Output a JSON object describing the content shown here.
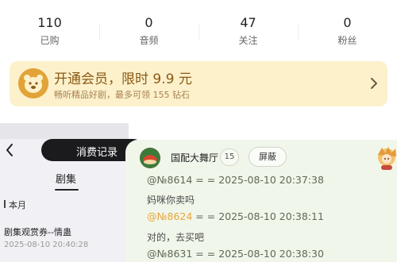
{
  "stats": [
    {
      "value": "110",
      "label": "已购"
    },
    {
      "value": "0",
      "label": "音频"
    },
    {
      "value": "47",
      "label": "关注"
    },
    {
      "value": "0",
      "label": "粉丝"
    }
  ],
  "vip": {
    "title": "开通会员，限时 9.9 元",
    "subtitle": "畅听精品好剧，最多可领 155 钻石",
    "icon": "bear-icon"
  },
  "purchase": {
    "tab_label": "消费记录",
    "category_tab": "剧集",
    "section": "本月",
    "record_title": "剧集观赏券--情蛊",
    "record_time": "2025-08-10 20:40:28"
  },
  "chat": {
    "room_name": "国配大舞厅",
    "member_count": "15",
    "block_label": "屏蔽",
    "messages": [
      {
        "user": "@№8614",
        "time": "= = 2025-08-10 20:37:38",
        "text": "妈咪你卖吗"
      },
      {
        "user": "@№8624",
        "time": "= = 2025-08-10 20:38:11",
        "text": "对的，去买吧"
      },
      {
        "user": "@№8631",
        "time": "= = 2025-08-10 20:38:30",
        "text": ""
      }
    ]
  },
  "colors": {
    "vip_bg": "#fdf1cc",
    "vip_text": "#8a5a14",
    "highlight_user": "#e8a63c",
    "chat_bg": "#f0f6ea"
  }
}
